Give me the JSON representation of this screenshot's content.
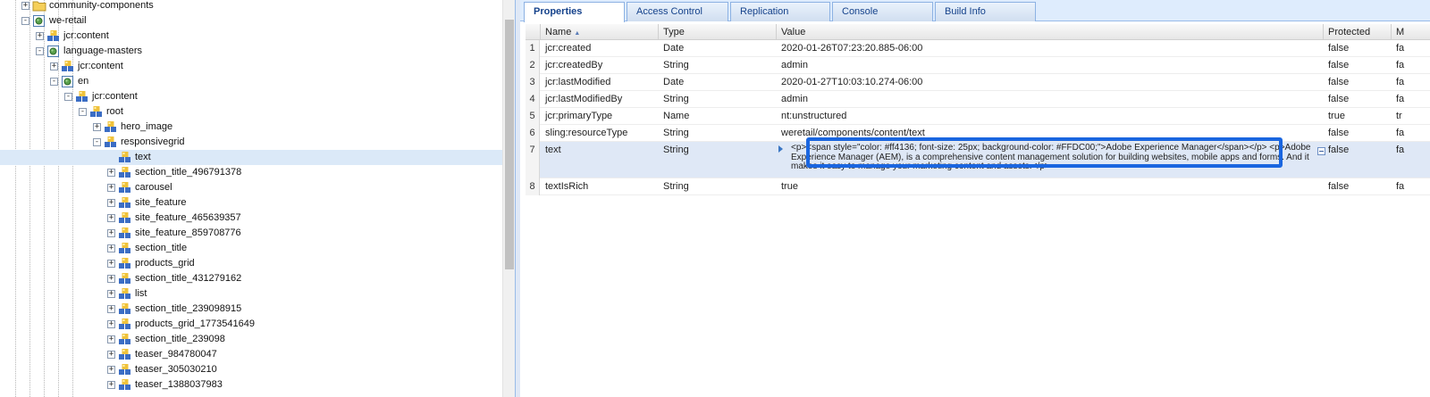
{
  "tree": {
    "nodes": [
      {
        "label": "community-components",
        "icon": "folder-icon",
        "expander": "+",
        "selected": false
      },
      {
        "label": "we-retail",
        "icon": "page-node-icon",
        "expander": "-",
        "selected": false
      },
      {
        "label": "jcr:content",
        "icon": "component-node-icon",
        "expander": "+",
        "selected": false
      },
      {
        "label": "language-masters",
        "icon": "page-node-icon",
        "expander": "-",
        "selected": false
      },
      {
        "label": "jcr:content",
        "icon": "component-node-icon",
        "expander": "+",
        "selected": false
      },
      {
        "label": "en",
        "icon": "page-node-icon",
        "expander": "-",
        "selected": false
      },
      {
        "label": "jcr:content",
        "icon": "component-node-icon",
        "expander": "-",
        "selected": false
      },
      {
        "label": "root",
        "icon": "component-node-icon",
        "expander": "-",
        "selected": false
      },
      {
        "label": "hero_image",
        "icon": "component-node-icon",
        "expander": "+",
        "selected": false
      },
      {
        "label": "responsivegrid",
        "icon": "component-node-icon",
        "expander": "-",
        "selected": false
      },
      {
        "label": "text",
        "icon": "component-node-icon",
        "expander": "",
        "selected": true
      },
      {
        "label": "section_title_496791378",
        "icon": "component-node-icon",
        "expander": "+",
        "selected": false
      },
      {
        "label": "carousel",
        "icon": "component-node-icon",
        "expander": "+",
        "selected": false
      },
      {
        "label": "site_feature",
        "icon": "component-node-icon",
        "expander": "+",
        "selected": false
      },
      {
        "label": "site_feature_465639357",
        "icon": "component-node-icon",
        "expander": "+",
        "selected": false
      },
      {
        "label": "site_feature_859708776",
        "icon": "component-node-icon",
        "expander": "+",
        "selected": false
      },
      {
        "label": "section_title",
        "icon": "component-node-icon",
        "expander": "+",
        "selected": false
      },
      {
        "label": "products_grid",
        "icon": "component-node-icon",
        "expander": "+",
        "selected": false
      },
      {
        "label": "section_title_431279162",
        "icon": "component-node-icon",
        "expander": "+",
        "selected": false
      },
      {
        "label": "list",
        "icon": "component-node-icon",
        "expander": "+",
        "selected": false
      },
      {
        "label": "section_title_239098915",
        "icon": "component-node-icon",
        "expander": "+",
        "selected": false
      },
      {
        "label": "products_grid_1773541649",
        "icon": "component-node-icon",
        "expander": "+",
        "selected": false
      },
      {
        "label": "section_title_239098",
        "icon": "component-node-icon",
        "expander": "+",
        "selected": false
      },
      {
        "label": "teaser_984780047",
        "icon": "component-node-icon",
        "expander": "+",
        "selected": false
      },
      {
        "label": "teaser_305030210",
        "icon": "component-node-icon",
        "expander": "+",
        "selected": false
      },
      {
        "label": "teaser_1388037983",
        "icon": "component-node-icon",
        "expander": "+",
        "selected": false
      }
    ]
  },
  "tabs": [
    {
      "label": "Properties",
      "active": true
    },
    {
      "label": "Access Control",
      "active": false
    },
    {
      "label": "Replication",
      "active": false
    },
    {
      "label": "Console",
      "active": false
    },
    {
      "label": "Build Info",
      "active": false
    }
  ],
  "grid": {
    "columns": [
      "Name",
      "Type",
      "Value",
      "Protected",
      "M"
    ],
    "sort_column": "Name",
    "sort_direction": "ascending",
    "rows": [
      {
        "num": "1",
        "name": "jcr:created",
        "type": "Date",
        "value": "2020-01-26T07:23:20.885-06:00",
        "protected": "false",
        "m": "fa"
      },
      {
        "num": "2",
        "name": "jcr:createdBy",
        "type": "String",
        "value": "admin",
        "protected": "false",
        "m": "fa"
      },
      {
        "num": "3",
        "name": "jcr:lastModified",
        "type": "Date",
        "value": "2020-01-27T10:03:10.274-06:00",
        "protected": "false",
        "m": "fa"
      },
      {
        "num": "4",
        "name": "jcr:lastModifiedBy",
        "type": "String",
        "value": "admin",
        "protected": "false",
        "m": "fa"
      },
      {
        "num": "5",
        "name": "jcr:primaryType",
        "type": "Name",
        "value": "nt:unstructured",
        "protected": "true",
        "m": "tr"
      },
      {
        "num": "6",
        "name": "sling:resourceType",
        "type": "String",
        "value": "weretail/components/content/text",
        "protected": "false",
        "m": "fa"
      },
      {
        "num": "7",
        "name": "text",
        "type": "String",
        "value": "<p><span style=\"color: #ff4136; font-size: 25px; background-color: #FFDC00;\">Adobe Experience Manager</span></p> <p>Adobe Experience Manager (AEM), is a comprehensive content management solution for building websites, mobile apps and forms. And it makes it easy to manage your marketing content and assets.</p>",
        "protected": "false",
        "m": "fa"
      },
      {
        "num": "8",
        "name": "textIsRich",
        "type": "String",
        "value": "true",
        "protected": "false",
        "m": "fa"
      }
    ]
  },
  "colors": {
    "highlight_border": "#1a66e0",
    "selected_row": "#dfe8f6",
    "tab_text": "#15428b"
  }
}
